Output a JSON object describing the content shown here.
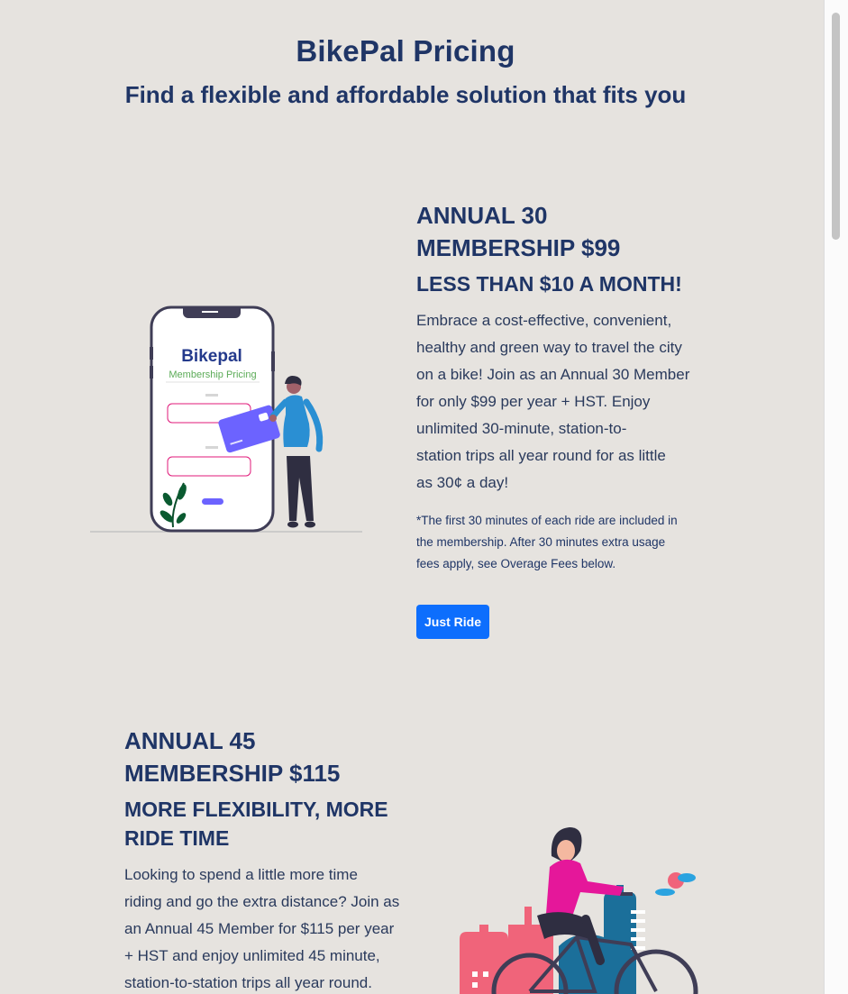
{
  "header": {
    "title": "BikePal Pricing",
    "subtitle": "Find a flexible and affordable solution that fits you"
  },
  "plans": [
    {
      "title_line1": "ANNUAL 30",
      "title_line2": "MEMBERSHIP $99",
      "tagline": "LESS THAN $10 A MONTH!",
      "body_lines": [
        "Embrace a cost-effective, convenient,",
        "healthy and green way to travel the city",
        "on a bike! Join as an Annual 30 Member",
        "for only $99 per year + HST. Enjoy",
        "unlimited 30-minute, station-to-",
        "station trips all year round for as little",
        "as 30¢ a day!"
      ],
      "note_lines": [
        "*The first 30 minutes of each ride are included in",
        "the membership. After 30 minutes extra usage",
        "fees apply, see Overage Fees below."
      ],
      "button_label": "Just Ride",
      "illustration": {
        "phone_title": "Bikepal",
        "phone_subtitle": "Membership Pricing"
      }
    },
    {
      "title_line1": "ANNUAL 45",
      "title_line2": "MEMBERSHIP $115",
      "tagline_line1": "MORE FLEXIBILITY, MORE",
      "tagline_line2": "RIDE TIME",
      "body_lines": [
        "Looking to spend a little more time",
        "riding and go the extra distance? Join as",
        "an Annual 45 Member for $115 per year",
        "+ HST and enjoy unlimited 45 minute,",
        "station-to-station trips all year round."
      ]
    }
  ],
  "colors": {
    "background": "#e6e3df",
    "heading": "#1f3566",
    "button": "#0d6efd"
  }
}
